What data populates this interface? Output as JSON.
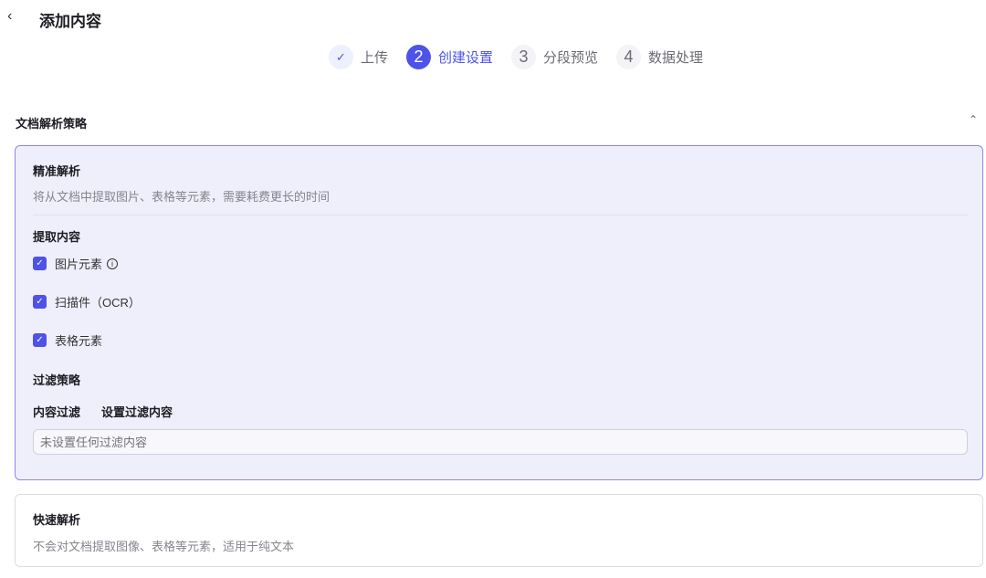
{
  "header": {
    "title": "添加内容",
    "back_icon": "chevron-left"
  },
  "steps": [
    {
      "num": "✓",
      "label": "上传",
      "state": "done"
    },
    {
      "num": "2",
      "label": "创建设置",
      "state": "active"
    },
    {
      "num": "3",
      "label": "分段预览",
      "state": "pending"
    },
    {
      "num": "4",
      "label": "数据处理",
      "state": "pending"
    }
  ],
  "section": {
    "title": "文档解析策略"
  },
  "precise": {
    "title": "精准解析",
    "desc": "将从文档中提取图片、表格等元素，需要耗费更长的时间",
    "extract_title": "提取内容",
    "options": [
      {
        "label": "图片元素",
        "checked": true
      },
      {
        "label": "扫描件（OCR）",
        "checked": true
      },
      {
        "label": "表格元素",
        "checked": true
      }
    ],
    "filter_title": "过滤策略",
    "filter_label": "内容过滤",
    "filter_link": "设置过滤内容",
    "filter_placeholder": "未设置任何过滤内容"
  },
  "fast": {
    "title": "快速解析",
    "desc": "不会对文档提取图像、表格等元素，适用于纯文本"
  }
}
